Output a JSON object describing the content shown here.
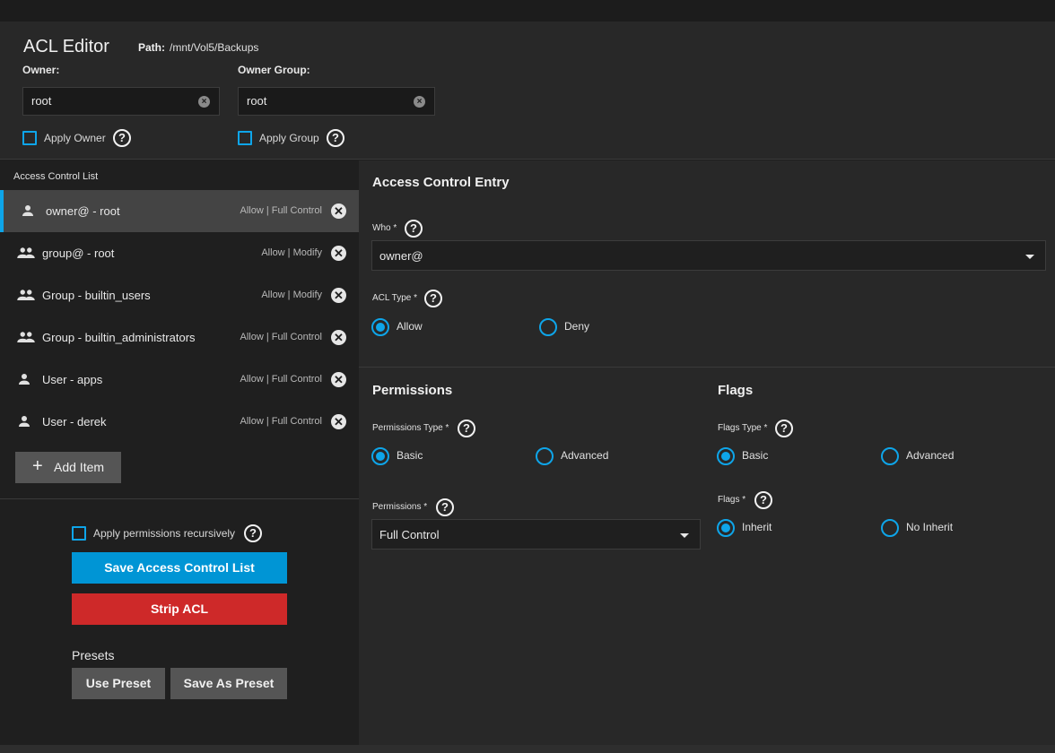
{
  "header": {
    "title": "ACL Editor",
    "path_label": "Path:",
    "path_value": "/mnt/Vol5/Backups",
    "owner": {
      "label": "Owner:",
      "value": "root",
      "apply_label": "Apply Owner"
    },
    "owner_group": {
      "label": "Owner Group:",
      "value": "root",
      "apply_label": "Apply Group"
    },
    "help_glyph": "?"
  },
  "acl_list": {
    "heading": "Access Control List",
    "items": [
      {
        "name": "owner@ - root",
        "perm": "Allow | Full Control",
        "icon": "person-icon",
        "selected": true
      },
      {
        "name": "group@ - root",
        "perm": "Allow | Modify",
        "icon": "group-icon",
        "selected": false
      },
      {
        "name": "Group - builtin_users",
        "perm": "Allow | Modify",
        "icon": "group-icon",
        "selected": false
      },
      {
        "name": "Group - builtin_administrators",
        "perm": "Allow | Full Control",
        "icon": "group-icon",
        "selected": false
      },
      {
        "name": "User - apps",
        "perm": "Allow | Full Control",
        "icon": "person-icon",
        "selected": false
      },
      {
        "name": "User - derek",
        "perm": "Allow | Full Control",
        "icon": "person-icon",
        "selected": false
      }
    ],
    "add_label": "Add Item",
    "add_glyph": "+",
    "delete_glyph": "✕"
  },
  "actions": {
    "recursive_label": "Apply permissions recursively",
    "save_label": "Save Access Control List",
    "strip_label": "Strip ACL",
    "presets_heading": "Presets",
    "use_preset_label": "Use Preset",
    "save_preset_label": "Save As Preset"
  },
  "entry": {
    "title": "Access Control Entry",
    "who_label": "Who *",
    "who_value": "owner@",
    "acl_type_label": "ACL Type *",
    "acl_type_options": [
      "Allow",
      "Deny"
    ],
    "acl_type_selected": "Allow"
  },
  "permissions": {
    "title": "Permissions",
    "type_label": "Permissions Type *",
    "type_options": [
      "Basic",
      "Advanced"
    ],
    "type_selected": "Basic",
    "perm_label": "Permissions *",
    "perm_value": "Full Control"
  },
  "flags": {
    "title": "Flags",
    "type_label": "Flags Type *",
    "type_options": [
      "Basic",
      "Advanced"
    ],
    "type_selected": "Basic",
    "flags_label": "Flags *",
    "flags_options": [
      "Inherit",
      "No Inherit"
    ],
    "flags_selected": "Inherit"
  },
  "colors": {
    "accent": "#0ea5e9",
    "primary_button": "#0095d5",
    "danger_button": "#ce2929",
    "panel": "#282828",
    "background": "#1f1f1f"
  }
}
